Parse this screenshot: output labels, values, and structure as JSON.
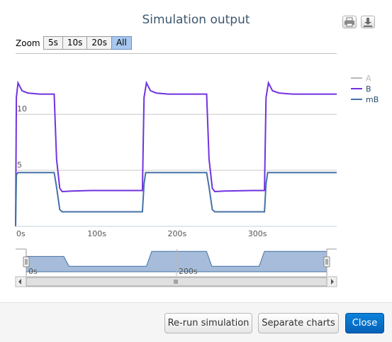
{
  "dialog": {
    "title": "Simulation output",
    "print_icon": "printer-icon",
    "export_icon": "download-icon"
  },
  "zoom": {
    "label": "Zoom",
    "buttons": [
      "5s",
      "10s",
      "20s",
      "All"
    ],
    "active": "All"
  },
  "chart_data": {
    "type": "line",
    "title": "",
    "xlabel": "",
    "ylabel": "",
    "x_range": [
      0,
      400
    ],
    "ylim": [
      0,
      14.5
    ],
    "x_ticks": [
      "0s",
      "100s",
      "200s",
      "300s"
    ],
    "y_ticks": [
      "5",
      "10"
    ],
    "grid": true,
    "legend_position": "top-right",
    "series": [
      {
        "name": "A",
        "color": "#b8b8b8",
        "visible": false,
        "x": [],
        "y": []
      },
      {
        "name": "B",
        "color": "#7132e0",
        "x": [
          0,
          1,
          3,
          8,
          15,
          30,
          48,
          51,
          55,
          58,
          70,
          95,
          140,
          158,
          160,
          163,
          168,
          175,
          190,
          222,
          238,
          241,
          245,
          248,
          260,
          295,
          310,
          312,
          315,
          320,
          328,
          345,
          400
        ],
        "y": [
          0,
          11.5,
          12.8,
          12.1,
          11.9,
          11.8,
          11.8,
          6,
          3.4,
          3.1,
          3.15,
          3.2,
          3.2,
          3.2,
          11.5,
          12.8,
          12.1,
          11.9,
          11.8,
          11.8,
          11.8,
          6,
          3.4,
          3.1,
          3.15,
          3.2,
          3.2,
          11.5,
          12.8,
          12.1,
          11.9,
          11.8,
          11.8
        ]
      },
      {
        "name": "mB",
        "color": "#4572a7",
        "x": [
          0,
          1,
          3,
          48,
          51,
          55,
          58,
          158,
          160,
          162,
          238,
          241,
          245,
          248,
          310,
          312,
          314,
          400
        ],
        "y": [
          0,
          4.6,
          4.8,
          4.8,
          3.5,
          1.5,
          1.3,
          1.3,
          3.8,
          4.8,
          4.8,
          3.5,
          1.5,
          1.3,
          1.3,
          3.8,
          4.8,
          4.8
        ]
      }
    ]
  },
  "navigator": {
    "tick_labels": [
      "0s",
      "200s"
    ],
    "series_x": [
      0,
      50,
      57,
      160,
      167,
      240,
      247,
      310,
      317,
      400
    ],
    "series_y": [
      3.6,
      3.6,
      1.3,
      1.3,
      4.8,
      4.8,
      1.3,
      1.3,
      4.8,
      4.8
    ]
  },
  "footer": {
    "rerun_label": "Re-run simulation",
    "separate_label": "Separate charts",
    "close_label": "Close"
  }
}
